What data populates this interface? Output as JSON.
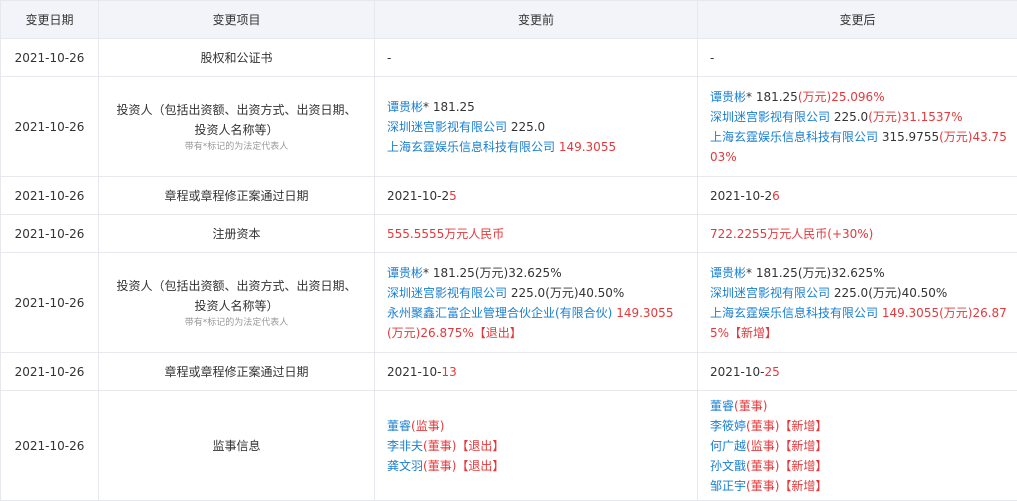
{
  "headers": {
    "date": "变更日期",
    "item": "变更项目",
    "before": "变更前",
    "after": "变更后"
  },
  "hint": "带有*标记的为法定代表人",
  "rows": [
    {
      "date": "2021-10-26",
      "item": "股权和公证书",
      "before": "-",
      "after": "-"
    },
    {
      "date": "2021-10-26",
      "item1": "投资人（包括出资额、出资方式、出资日期、",
      "item2": "投资人名称等）",
      "before": [
        {
          "name": "谭贵彬",
          "mark": "*",
          "amount": " 181.25",
          "unit": "",
          "pct": ""
        },
        {
          "name": "深圳迷宫影视有限公司",
          "amount": " 225.0",
          "unit": "",
          "pct": ""
        },
        {
          "name": "上海玄霆娱乐信息科技有限公司",
          "amount": "",
          "red": " 149.3055"
        }
      ],
      "after": [
        {
          "name": "谭贵彬",
          "mark": "*",
          "amount": " 181.25",
          "unit": "(万元)",
          "pct": "25.096%"
        },
        {
          "name": "深圳迷宫影视有限公司",
          "amount": " 225.0",
          "unit": "(万元)",
          "pct": "31.1537%"
        },
        {
          "name": "上海玄霆娱乐信息科技有限公司",
          "amount": " 315.9755",
          "unit": "(万元)",
          "pct": "43.75",
          "wrap": "03%"
        }
      ]
    },
    {
      "date": "2021-10-26",
      "item": "章程或章程修正案通过日期",
      "before_a": "2021-10-2",
      "before_b": "5",
      "after_a": "2021-10-2",
      "after_b": "6"
    },
    {
      "date": "2021-10-26",
      "item": "注册资本",
      "before": "555.5555万元人民币",
      "after": "722.2255万元人民币(+30%)"
    },
    {
      "date": "2021-10-26",
      "item1": "投资人（包括出资额、出资方式、出资日期、",
      "item2": "投资人名称等）",
      "before": [
        {
          "name": "谭贵彬",
          "mark": "*",
          "amount": " 181.25",
          "unit": "(万元)",
          "pct": "32.625%"
        },
        {
          "name": "深圳迷宫影视有限公司",
          "amount": " 225.0",
          "unit": "(万元)",
          "pct": "40.50%"
        },
        {
          "name": "永州聚鑫汇富企业管理合伙企业(有限合伙)",
          "red": " 149.3055",
          "wrap": "(万元)26.875%",
          "tag": "【退出】"
        }
      ],
      "after": [
        {
          "name": "谭贵彬",
          "mark": "*",
          "amount": " 181.25",
          "unit": "(万元)",
          "pct": "32.625%"
        },
        {
          "name": "深圳迷宫影视有限公司",
          "amount": " 225.0",
          "unit": "(万元)",
          "pct": "40.50%"
        },
        {
          "name": "上海玄霆娱乐信息科技有限公司",
          "red": " 149.3055",
          "unit2": "(万元)26.87",
          "wrap": "5%",
          "tag": "【新增】"
        }
      ]
    },
    {
      "date": "2021-10-26",
      "item": "章程或章程修正案通过日期",
      "before_a": "2021-10-",
      "before_b": "13",
      "after_a": "2021-10-",
      "after_b": "25"
    },
    {
      "date": "2021-10-26",
      "item": "监事信息",
      "before": [
        {
          "name": "董睿",
          "role": "(监事)"
        },
        {
          "name": "李非夫",
          "role": "(董事)",
          "tag": "【退出】"
        },
        {
          "name": "龚文羽",
          "role": "(董事)",
          "tag": "【退出】"
        }
      ],
      "after": [
        {
          "name": "董睿",
          "role": "(董事)"
        },
        {
          "name": "李筱婷",
          "role": "(董事)",
          "tag": "【新增】"
        },
        {
          "name": "何广越",
          "role": "(监事)",
          "tag": "【新增】"
        },
        {
          "name": "孙文戬",
          "role": "(董事)",
          "tag": "【新增】"
        },
        {
          "name": "邹正宇",
          "role": "(董事)",
          "tag": "【新增】"
        }
      ]
    }
  ]
}
